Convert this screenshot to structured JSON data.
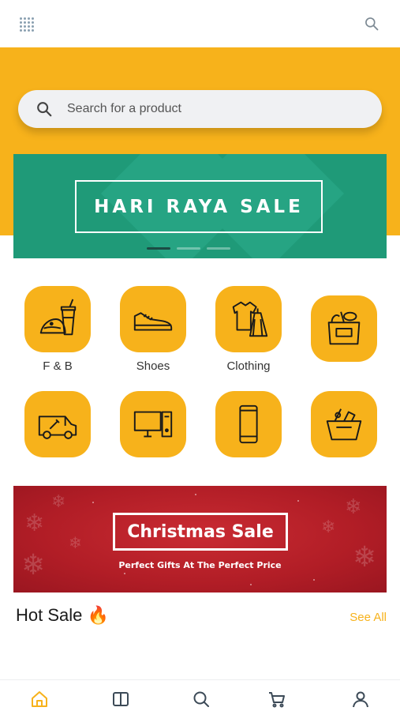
{
  "topbar": {
    "menu_icon": "grid-dots-icon",
    "search_icon": "search-icon"
  },
  "search": {
    "placeholder": "Search for a product",
    "value": ""
  },
  "promo_banner": {
    "text": "HARI RAYA SALE",
    "slide_count": 3,
    "active_slide": 1,
    "background": "#1f9a78"
  },
  "categories": [
    {
      "label": "F & B",
      "icon": "food-drink-icon"
    },
    {
      "label": "Shoes",
      "icon": "sneaker-icon"
    },
    {
      "label": "Clothing",
      "icon": "clothing-icon"
    },
    {
      "label": "",
      "icon": "grocery-bag-icon"
    },
    {
      "label": "",
      "icon": "repair-van-icon"
    },
    {
      "label": "",
      "icon": "desktop-computer-icon"
    },
    {
      "label": "",
      "icon": "smartphone-icon"
    },
    {
      "label": "",
      "icon": "grocery-basket-icon"
    }
  ],
  "christmas_banner": {
    "title": "Christmas Sale",
    "subtitle": "Perfect Gifts At The Perfect Price"
  },
  "hot_sale": {
    "title": "Hot Sale 🔥",
    "see_all": "See All"
  },
  "bottom_nav": [
    {
      "name": "home",
      "icon": "home-icon",
      "active": true
    },
    {
      "name": "catalog",
      "icon": "book-icon",
      "active": false
    },
    {
      "name": "search",
      "icon": "search-icon",
      "active": false
    },
    {
      "name": "cart",
      "icon": "cart-icon",
      "active": false
    },
    {
      "name": "profile",
      "icon": "user-icon",
      "active": false
    }
  ],
  "colors": {
    "accent": "#f7b21b",
    "teal": "#1f9a78",
    "christmas_red": "#b11d26"
  }
}
